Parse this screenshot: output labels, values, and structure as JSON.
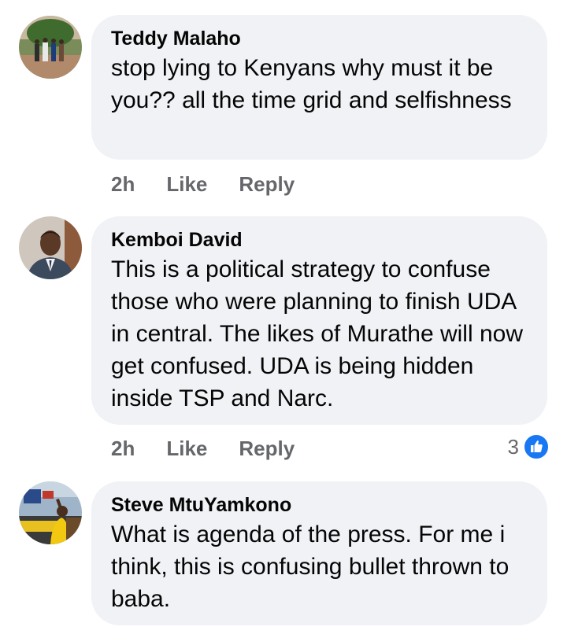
{
  "comments": [
    {
      "author": "Teddy Malaho",
      "text": "stop lying to Kenyans  why must it be you?? all the time grid and selfishness",
      "time": "2h",
      "like_label": "Like",
      "reply_label": "Reply",
      "avatar_icon": "avatar-photo-group"
    },
    {
      "author": "Kemboi David",
      "text": "This is a political strategy to confuse those who were planning to finish UDA in central. The likes of Murathe will now get confused. UDA is being hidden inside TSP and Narc.",
      "time": "2h",
      "like_label": "Like",
      "reply_label": "Reply",
      "reaction_count": "3",
      "reaction_icon": "thumbs-up-icon",
      "avatar_icon": "avatar-photo-man"
    },
    {
      "author": "Steve MtuYamkono",
      "text": "What is agenda of the press. For me i think, this is confusing bullet thrown to baba.",
      "avatar_icon": "avatar-photo-rally"
    }
  ],
  "colors": {
    "bubble_bg": "#f0f2f5",
    "meta_text": "#65676b",
    "like_blue": "#1877f2"
  }
}
